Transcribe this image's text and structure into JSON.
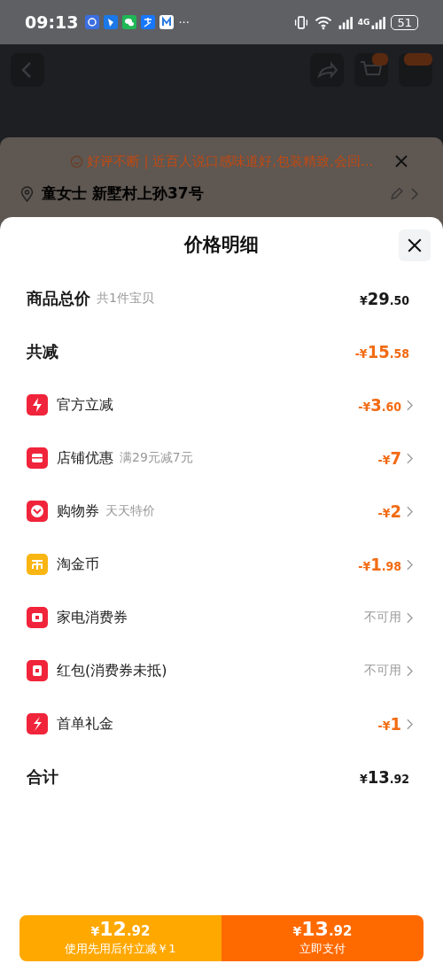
{
  "status_bar": {
    "time": "09:13",
    "more": "···",
    "battery": "51",
    "network": "4G"
  },
  "banner": {
    "text": "好评不断 | 近百人说口感味道好,包装精致,会回..."
  },
  "address": {
    "text": "童女士 新墅村上孙37号"
  },
  "sheet": {
    "title": "价格明细"
  },
  "rows": [
    {
      "kind": "summary",
      "label": "商品总价",
      "note": "共1件宝贝",
      "value": {
        "kind": "plain",
        "prefix": "¥",
        "main": "29",
        "decimals": ".50"
      },
      "chevron": false
    },
    {
      "kind": "summary",
      "label": "共减",
      "value": {
        "kind": "discount",
        "prefix": "-¥",
        "main": "15",
        "decimals": ".58"
      },
      "chevron": false
    },
    {
      "kind": "item",
      "label": "官方立减",
      "value": {
        "kind": "discount",
        "prefix": "-¥",
        "main": "3",
        "decimals": ".60"
      },
      "chevron": true
    },
    {
      "kind": "item",
      "label": "店铺优惠",
      "note": "满29元减7元",
      "value": {
        "kind": "discount",
        "prefix": "-¥",
        "main": "7"
      },
      "chevron": true
    },
    {
      "kind": "item",
      "label": "购物券",
      "note": "天天特价",
      "value": {
        "kind": "discount",
        "prefix": "-¥",
        "main": "2"
      },
      "chevron": true
    },
    {
      "kind": "item",
      "label": "淘金币",
      "value": {
        "kind": "discount",
        "prefix": "-¥",
        "main": "1",
        "decimals": ".98"
      },
      "chevron": true
    },
    {
      "kind": "item",
      "label": "家电消费券",
      "value": {
        "kind": "text",
        "text": "不可用"
      },
      "chevron": true
    },
    {
      "kind": "item",
      "label": "红包(消费券未抵)",
      "value": {
        "kind": "text",
        "text": "不可用"
      },
      "chevron": true
    },
    {
      "kind": "item",
      "label": "首单礼金",
      "value": {
        "kind": "discount",
        "prefix": "-¥",
        "main": "1"
      },
      "chevron": true
    },
    {
      "kind": "summary",
      "label": "合计",
      "value": {
        "kind": "plain",
        "prefix": "¥",
        "main": "13",
        "decimals": ".92"
      },
      "chevron": false
    }
  ],
  "buttons": [
    {
      "kind": "later",
      "prefix": "¥",
      "main": "12",
      "decimals": ".92",
      "caption": "使用先用后付立减￥1"
    },
    {
      "kind": "now",
      "prefix": "¥",
      "main": "13",
      "decimals": ".92",
      "caption": "立即支付"
    }
  ]
}
